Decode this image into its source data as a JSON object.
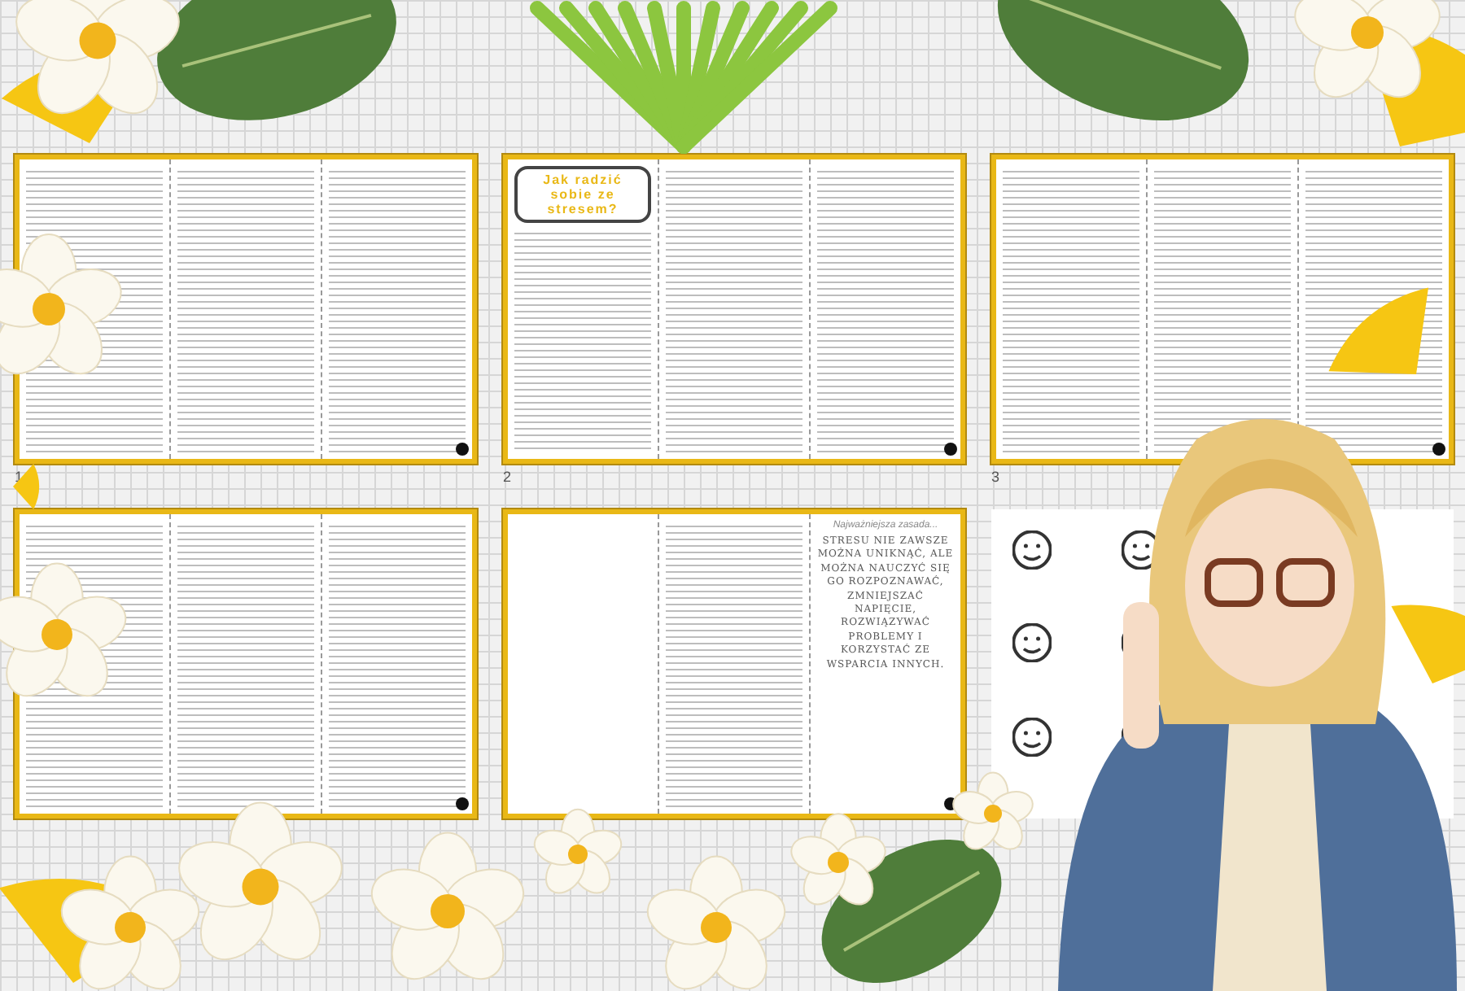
{
  "pages": [
    {
      "kind": "columns",
      "number": "1"
    },
    {
      "kind": "columns",
      "number": "2",
      "title": "Jak radzić sobie ze stresem?"
    },
    {
      "kind": "columns",
      "number": "3"
    },
    {
      "kind": "columns"
    },
    {
      "kind": "quote",
      "quote_heading": "Najważniejsza zasada...",
      "quote": "STRESU NIE ZAWSZE MOŻNA UNIKNĄĆ, ALE MOŻNA NAUCZYĆ SIĘ GO ROZPOZNAWAĆ, ZMNIEJSZAĆ NAPIĘCIE, ROZWIĄZYWAĆ PROBLEMY I KORZYSTAĆ ZE WSPARCIA INNYCH."
    },
    {
      "kind": "icons"
    }
  ]
}
